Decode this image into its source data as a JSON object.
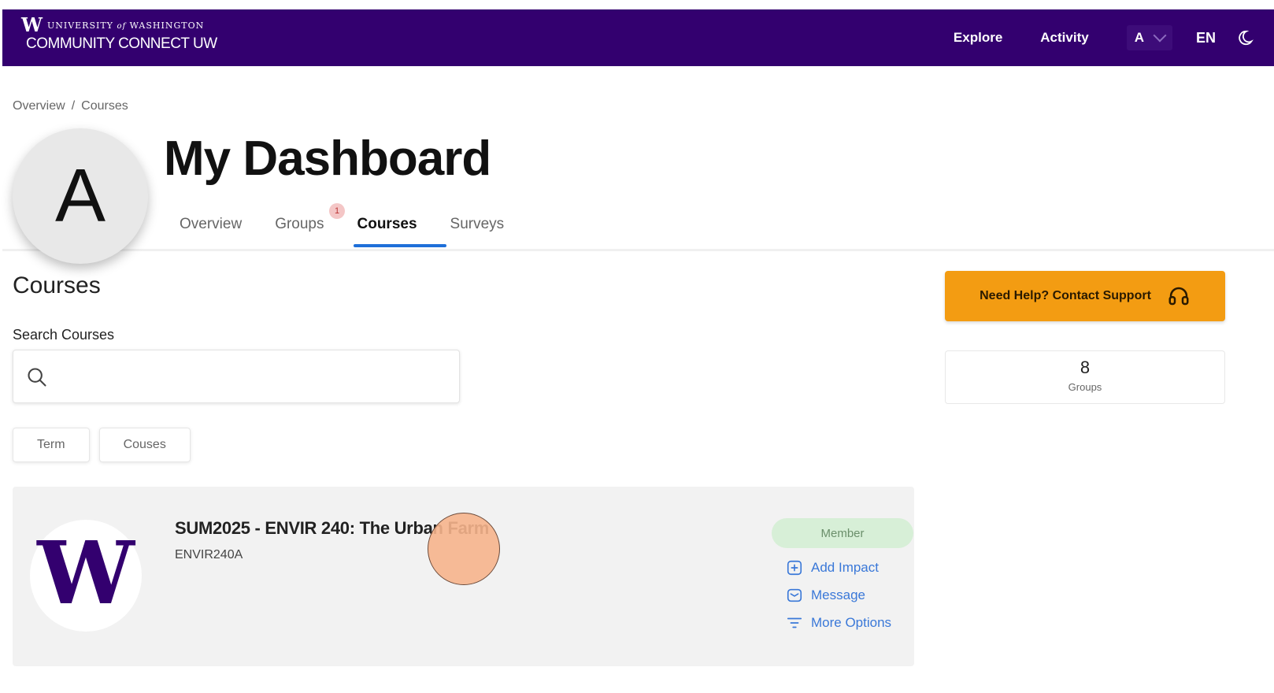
{
  "header": {
    "brand_mark": "W",
    "brand_university_pre": "UNIVERSITY",
    "brand_university_of": "of",
    "brand_university_post": "WASHINGTON",
    "brand_app": "COMMUNITY CONNECT UW",
    "nav": {
      "explore": "Explore",
      "activity": "Activity"
    },
    "avatar_letter": "A",
    "language": "EN",
    "colors": {
      "bar": "#33006f"
    },
    "icons": [
      "chevron-down-icon",
      "moon-icon"
    ]
  },
  "breadcrumb": {
    "items": [
      "Overview",
      "Courses"
    ],
    "separator": "/"
  },
  "profile": {
    "avatar_letter": "A"
  },
  "page": {
    "title": "My Dashboard"
  },
  "tabs": {
    "items": [
      "Overview",
      "Groups",
      "Courses",
      "Surveys"
    ],
    "active": "Courses",
    "groups_badge": "1"
  },
  "courses": {
    "section_title": "Courses",
    "search_label": "Search Courses",
    "search_value": "",
    "filters": [
      "Term",
      "Couses"
    ]
  },
  "course_card": {
    "logo_letter": "W",
    "title": "SUM2025 - ENVIR 240: The Urban Farm",
    "code": "ENVIR240A",
    "status": "Member",
    "actions": [
      "Add Impact",
      "Message",
      "More Options"
    ]
  },
  "sidebar": {
    "support_label": "Need Help? Contact Support",
    "groups_count": "8",
    "groups_label": "Groups",
    "colors": {
      "support": "#f39c12"
    }
  }
}
